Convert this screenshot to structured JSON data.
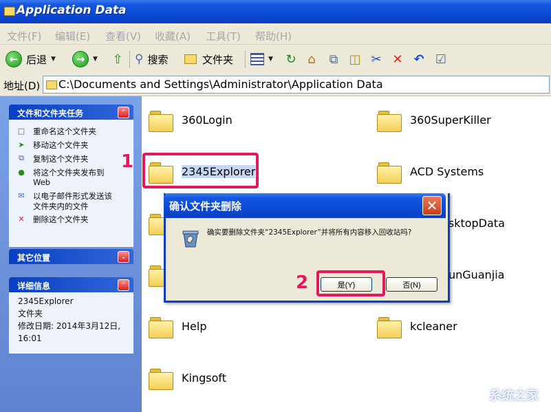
{
  "window": {
    "title": "Application Data"
  },
  "menu": [
    "文件(F)",
    "编辑(E)",
    "查看(V)",
    "收藏(A)",
    "工具(T)",
    "帮助(H)"
  ],
  "toolbar": {
    "back_label": "后退",
    "search_label": "搜索",
    "folders_label": "文件夹"
  },
  "address": {
    "label": "地址(D)",
    "path": "C:\\Documents and Settings\\Administrator\\Application Data"
  },
  "left_pane": {
    "tasks_header": "文件和文件夹任务",
    "tasks": [
      {
        "icon": "rename-icon",
        "label": "重命名这个文件夹"
      },
      {
        "icon": "move-icon",
        "label": "移动这个文件夹"
      },
      {
        "icon": "copy-icon",
        "label": "复制这个文件夹"
      },
      {
        "icon": "publish-web-icon",
        "label": "将这个文件夹发布到",
        "label2": "Web"
      },
      {
        "icon": "email-icon",
        "label": "以电子邮件形式发送该",
        "label2": "文件夹内的文件"
      },
      {
        "icon": "delete-icon",
        "label": "删除这个文件夹"
      }
    ],
    "other_places_header": "其它位置",
    "details_header": "详细信息",
    "details": {
      "name": "2345Explorer",
      "type": "文件夹",
      "modified_label": "修改日期: 2014年3月12日,",
      "modified_time": "16:01"
    }
  },
  "files": [
    {
      "name": "360Login"
    },
    {
      "name": "360SuperKiller"
    },
    {
      "name": "2345Explorer",
      "selected": true
    },
    {
      "name": "ACD Systems"
    },
    {
      "name": "esktopData"
    },
    {
      "name": "unGuanjia"
    },
    {
      "name": "Help"
    },
    {
      "name": "kcleaner"
    },
    {
      "name": "Kingsoft"
    }
  ],
  "annotations": {
    "step1": "1",
    "step2": "2"
  },
  "dialog": {
    "title": "确认文件夹删除",
    "message": "确实要删除文件夹“2345Explorer”并将所有内容移入回收站吗?",
    "yes_label": "是(Y)",
    "no_label": "否(N)"
  },
  "watermark": "系统之家",
  "colors": {
    "accent_red": "#e3185d",
    "xp_blue": "#0a4ad6"
  }
}
